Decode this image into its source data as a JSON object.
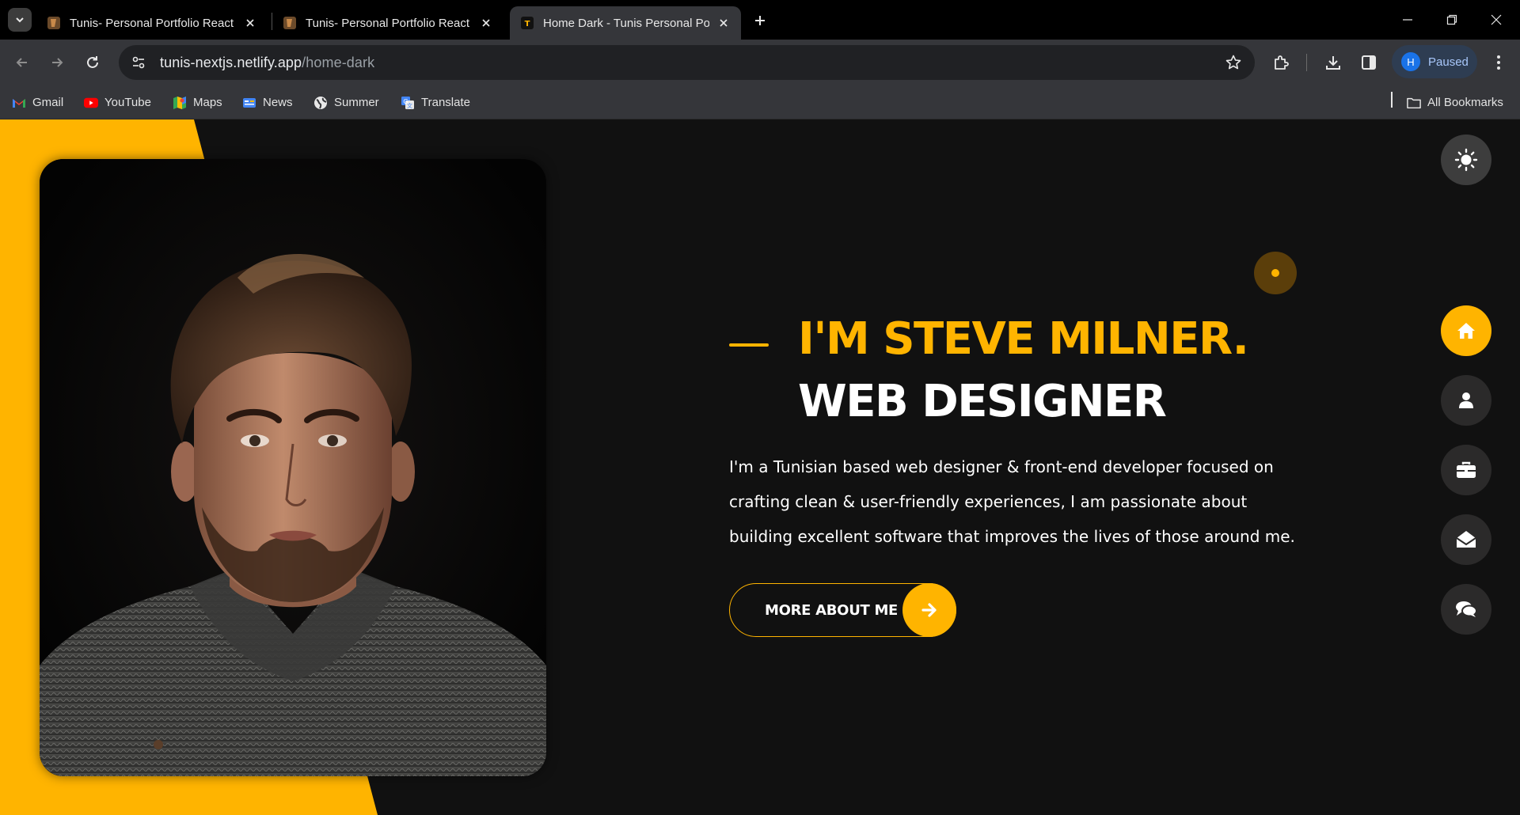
{
  "browser": {
    "tabs": [
      {
        "title": "Tunis- Personal Portfolio React",
        "active": false
      },
      {
        "title": "Tunis- Personal Portfolio React",
        "active": false
      },
      {
        "title": "Home Dark - Tunis Personal Por",
        "active": true
      }
    ],
    "address": {
      "host": "tunis-nextjs.netlify.app",
      "path": "/home-dark"
    },
    "profile": {
      "initial": "H",
      "status": "Paused"
    },
    "bookmarks": [
      {
        "label": "Gmail",
        "icon": "gmail-icon"
      },
      {
        "label": "YouTube",
        "icon": "youtube-icon"
      },
      {
        "label": "Maps",
        "icon": "maps-icon"
      },
      {
        "label": "News",
        "icon": "news-icon"
      },
      {
        "label": "Summer",
        "icon": "globe-icon"
      },
      {
        "label": "Translate",
        "icon": "translate-icon"
      }
    ],
    "all_bookmarks": "All Bookmarks"
  },
  "hero": {
    "name": "I'M STEVE MILNER.",
    "role": "WEB DESIGNER",
    "description": "I'm a Tunisian based web designer & front-end developer focused on crafting clean & user-friendly experiences, I am passionate about building excellent software that improves the lives of those around me.",
    "cta_label": "MORE ABOUT ME"
  },
  "sidenav": {
    "items": [
      {
        "name": "home",
        "icon": "home-icon",
        "active": true
      },
      {
        "name": "about",
        "icon": "user-icon",
        "active": false
      },
      {
        "name": "portfolio",
        "icon": "briefcase-icon",
        "active": false
      },
      {
        "name": "contact",
        "icon": "envelope-open-icon",
        "active": false
      },
      {
        "name": "blog",
        "icon": "comments-icon",
        "active": false
      }
    ]
  },
  "colors": {
    "accent": "#ffb400",
    "background": "#111111",
    "nav_button": "#2b2a2a"
  }
}
